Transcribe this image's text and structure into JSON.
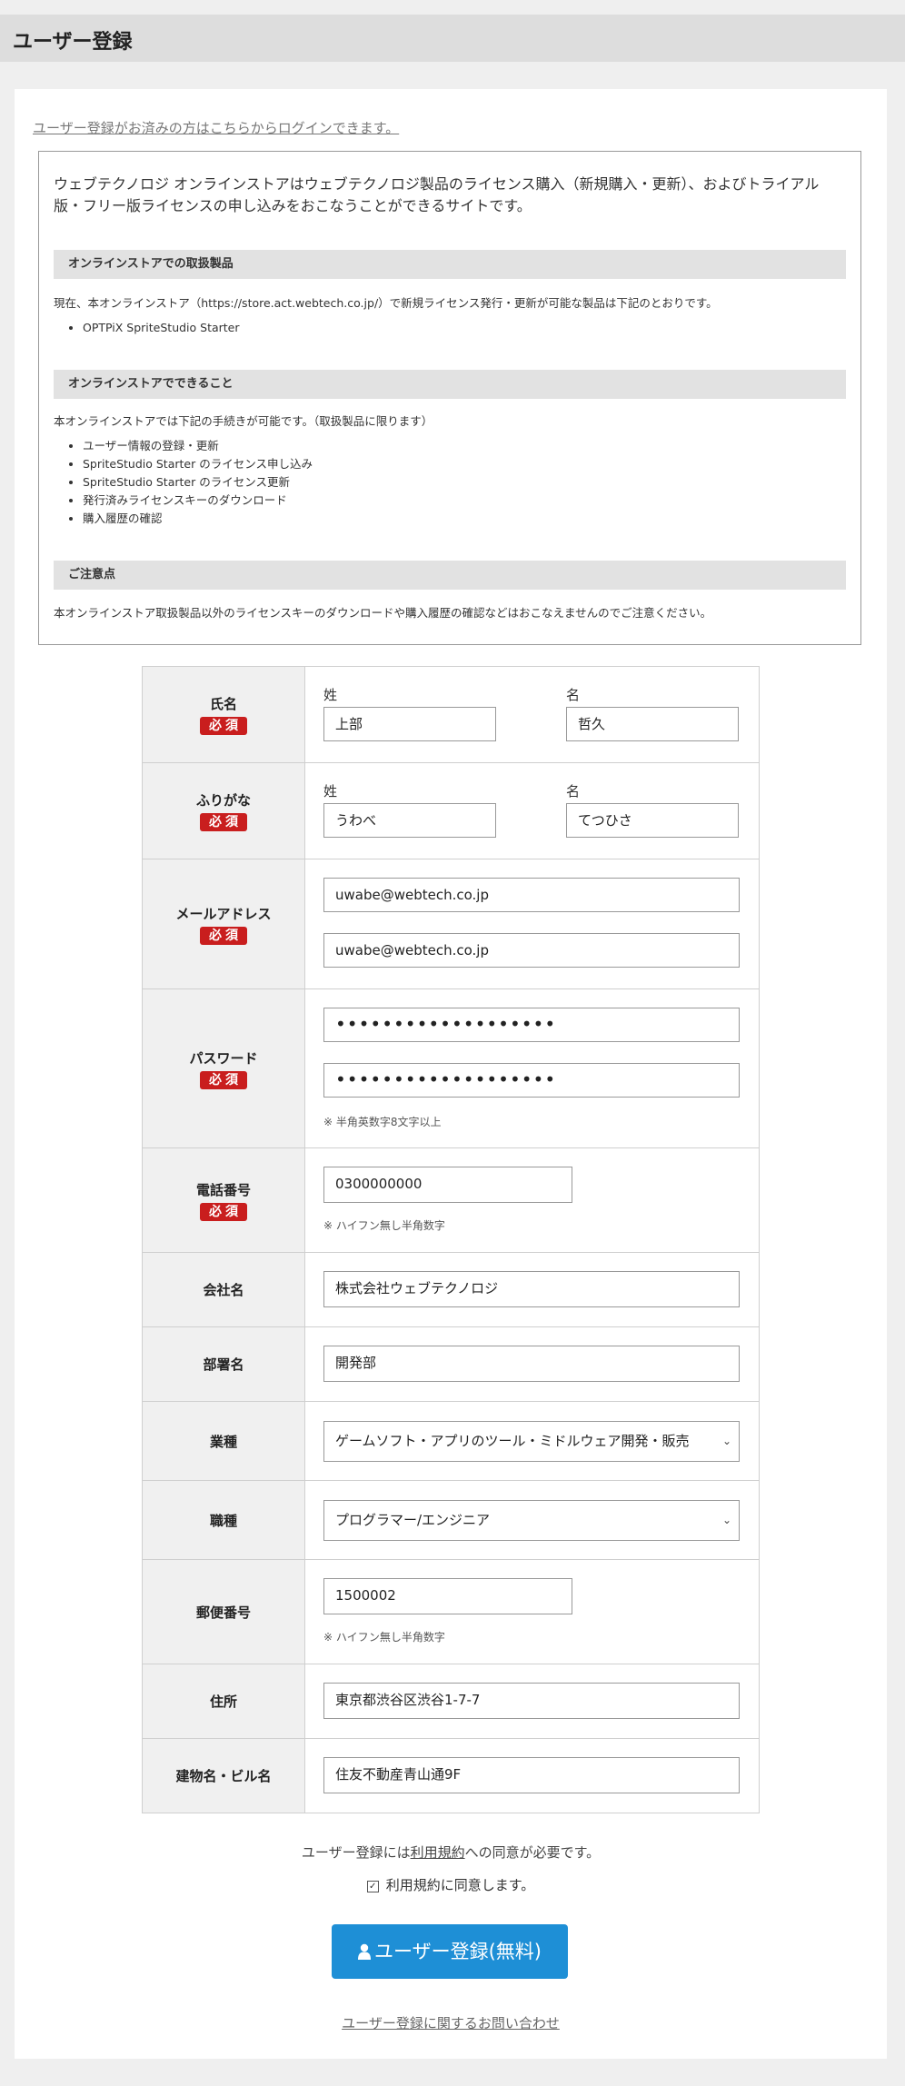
{
  "header": {
    "title": "ユーザー登録"
  },
  "login_link": "ユーザー登録がお済みの方はこちらからログインできます。",
  "info": {
    "intro": "ウェブテクノロジ オンラインストアはウェブテクノロジ製品のライセンス購入（新規購入・更新）、およびトライアル版・フリー版ライセンスの申し込みをおこなうことができるサイトです。",
    "sections": [
      {
        "heading": "オンラインストアでの取扱製品",
        "text": "現在、本オンラインストア（https://store.act.webtech.co.jp/）で新規ライセンス発行・更新が可能な製品は下記のとおりです。",
        "items": [
          "OPTPiX SpriteStudio Starter"
        ]
      },
      {
        "heading": "オンラインストアでできること",
        "text": "本オンラインストアでは下記の手続きが可能です。（取扱製品に限ります）",
        "items": [
          "ユーザー情報の登録・更新",
          "SpriteStudio Starter のライセンス申し込み",
          "SpriteStudio Starter のライセンス更新",
          "発行済みライセンスキーのダウンロード",
          "購入履歴の確認"
        ]
      },
      {
        "heading": "ご注意点",
        "text": "本オンラインストア取扱製品以外のライセンスキーのダウンロードや購入履歴の確認などはおこなえませんのでご注意ください。",
        "items": []
      }
    ]
  },
  "form": {
    "required_badge": "必須",
    "name": {
      "label": "氏名",
      "last_label": "姓",
      "first_label": "名",
      "last_value": "上部",
      "first_value": "哲久"
    },
    "kana": {
      "label": "ふりがな",
      "last_label": "姓",
      "first_label": "名",
      "last_value": "うわべ",
      "first_value": "てつひさ"
    },
    "email": {
      "label": "メールアドレス",
      "value": "uwabe@webtech.co.jp",
      "confirm_value": "uwabe@webtech.co.jp"
    },
    "password": {
      "label": "パスワード",
      "value": "•••••••••••••••••••",
      "confirm_value": "•••••••••••••••••••",
      "note": "※ 半角英数字8文字以上"
    },
    "phone": {
      "label": "電話番号",
      "value": "0300000000",
      "note": "※ ハイフン無し半角数字"
    },
    "company": {
      "label": "会社名",
      "value": "株式会社ウェブテクノロジ"
    },
    "department": {
      "label": "部署名",
      "value": "開発部"
    },
    "industry": {
      "label": "業種",
      "value": "ゲームソフト・アプリのツール・ミドルウェア開発・販売"
    },
    "occupation": {
      "label": "職種",
      "value": "プログラマー/エンジニア"
    },
    "zip": {
      "label": "郵便番号",
      "value": "1500002",
      "note": "※ ハイフン無し半角数字"
    },
    "address": {
      "label": "住所",
      "value": "東京都渋谷区渋谷1-7-7"
    },
    "building": {
      "label": "建物名・ビル名",
      "value": "住友不動産青山通9F"
    }
  },
  "agreement": {
    "pre": "ユーザー登録には",
    "terms_link": "利用規約",
    "post": "への同意が必要です。",
    "checkbox_label": "利用規約に同意します。",
    "checkbox_checked": true
  },
  "register_button": "ユーザー登録(無料)",
  "contact_link": "ユーザー登録に関するお問い合わせ"
}
